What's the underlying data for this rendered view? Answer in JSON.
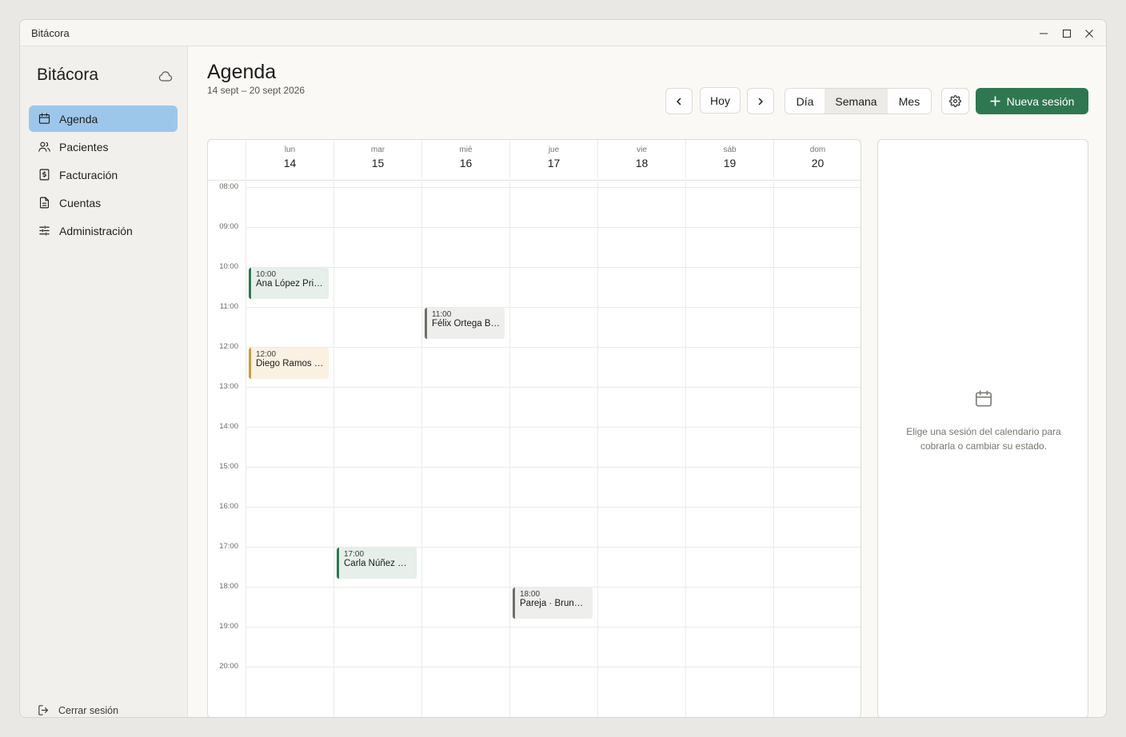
{
  "window": {
    "title": "Bitácora"
  },
  "sidebar": {
    "brand": "Bitácora",
    "items": [
      {
        "label": "Agenda",
        "icon": "calendar-icon",
        "active": true
      },
      {
        "label": "Pacientes",
        "icon": "users-icon",
        "active": false
      },
      {
        "label": "Facturación",
        "icon": "invoice-icon",
        "active": false
      },
      {
        "label": "Cuentas",
        "icon": "document-icon",
        "active": false
      },
      {
        "label": "Administración",
        "icon": "sliders-icon",
        "active": false
      }
    ],
    "logout_label": "Cerrar sesión"
  },
  "header": {
    "title": "Agenda",
    "range": "14 sept – 20 sept 2026",
    "today_label": "Hoy",
    "views": [
      "Día",
      "Semana",
      "Mes"
    ],
    "selected_view": "Semana",
    "new_session_label": "Nueva sesión"
  },
  "calendar": {
    "days": [
      {
        "name": "lun",
        "date": "14"
      },
      {
        "name": "mar",
        "date": "15"
      },
      {
        "name": "mié",
        "date": "16"
      },
      {
        "name": "jue",
        "date": "17"
      },
      {
        "name": "vie",
        "date": "18"
      },
      {
        "name": "sáb",
        "date": "19"
      },
      {
        "name": "dom",
        "date": "20"
      }
    ],
    "hours": [
      "08:00",
      "09:00",
      "10:00",
      "11:00",
      "12:00",
      "13:00",
      "14:00",
      "15:00",
      "16:00",
      "17:00",
      "18:00",
      "19:00",
      "20:00"
    ],
    "events": [
      {
        "day": 0,
        "time": "10:00",
        "name": "Ana López Prieto",
        "status": "green"
      },
      {
        "day": 2,
        "time": "11:00",
        "name": "Félix Ortega Bravo",
        "status": "gray"
      },
      {
        "day": 0,
        "time": "12:00",
        "name": "Diego Ramos Gil",
        "status": "amber"
      },
      {
        "day": 1,
        "time": "17:00",
        "name": "Carla Núñez Soto",
        "status": "green"
      },
      {
        "day": 3,
        "time": "18:00",
        "name": "Pareja · Bruno y Lía",
        "status": "gray"
      }
    ]
  },
  "detail": {
    "icon": "calendar-icon",
    "message": "Elige una sesión del calendario para cobrarla o cambiar su estado."
  },
  "colors": {
    "accent": "#2e7751",
    "active_nav": "#9dc7ea",
    "event_green": "#2e7751",
    "event_gray": "#6e6e6a",
    "event_amber": "#d09a3b"
  }
}
